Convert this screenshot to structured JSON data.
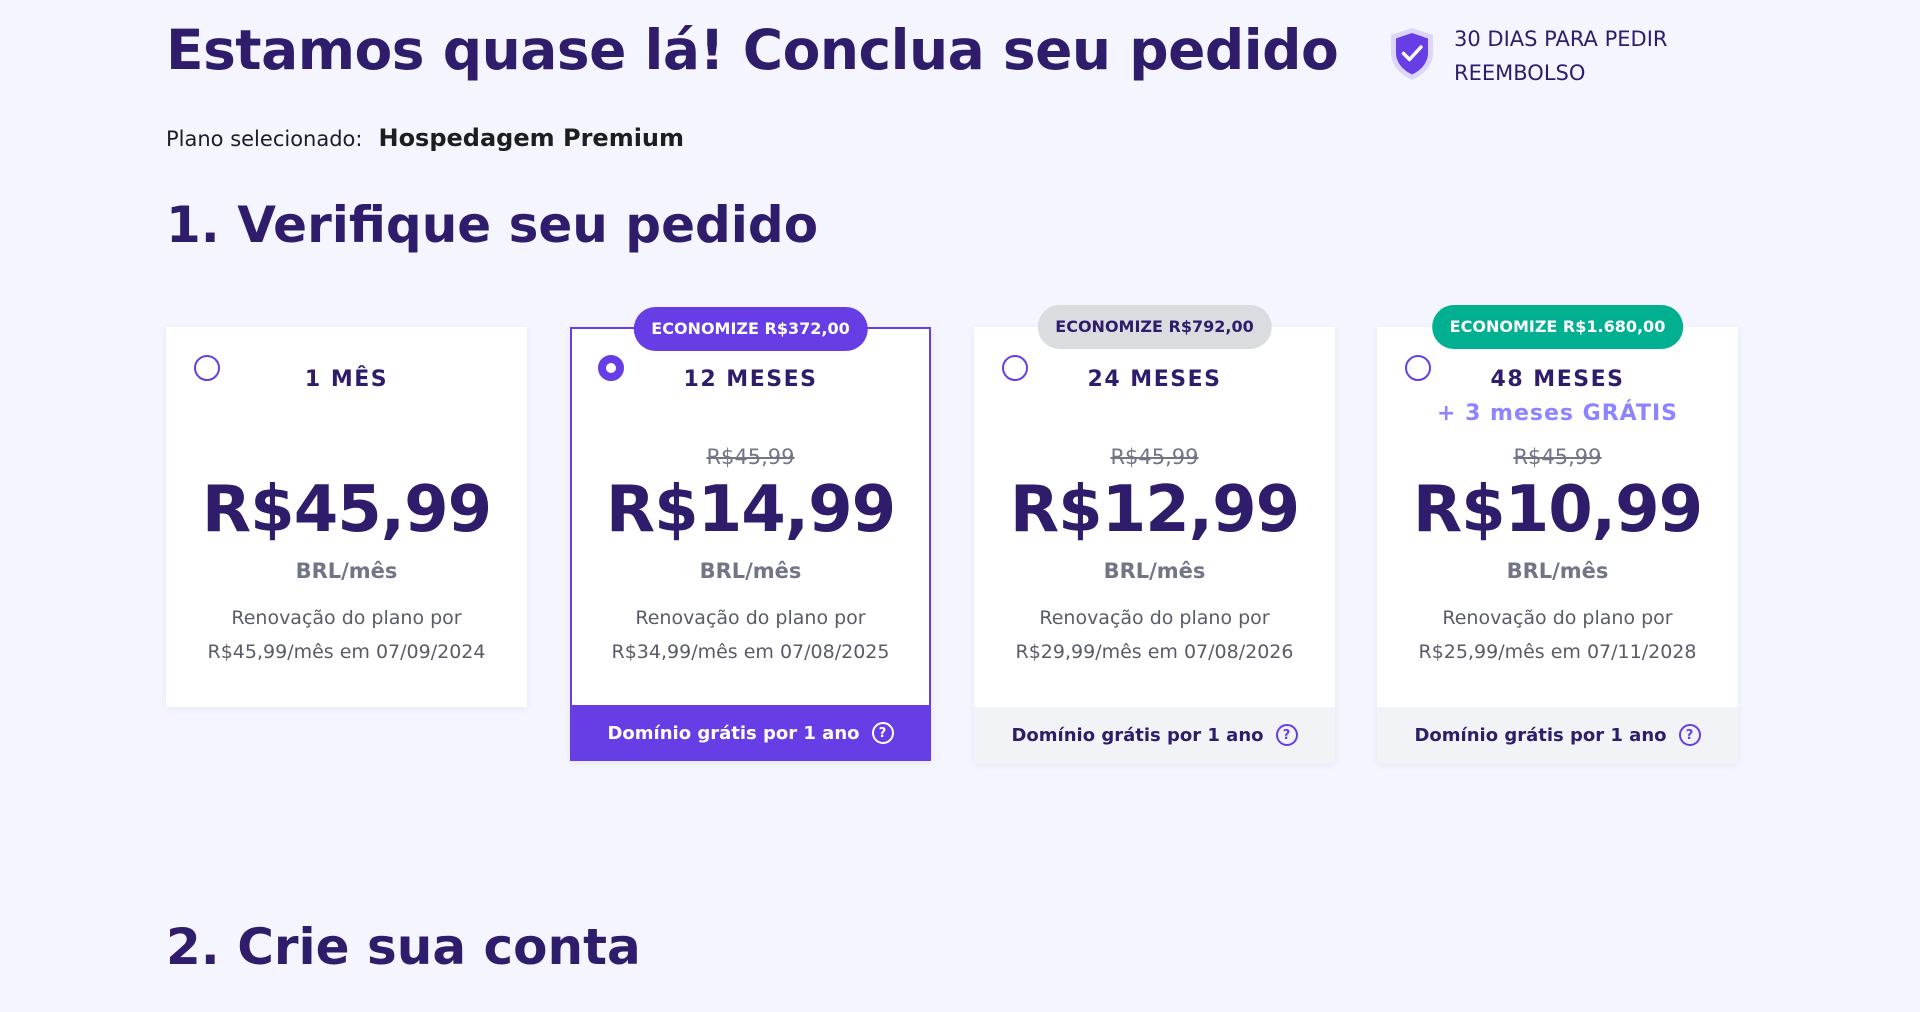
{
  "header": {
    "title": "Estamos quase lá! Conclua seu pedido",
    "guarantee_text": "30 DIAS PARA PEDIR REEMBOLSO"
  },
  "plan": {
    "label": "Plano selecionado:",
    "name": "Hospedagem Premium"
  },
  "sections": {
    "review_title": "1. Verifique seu pedido",
    "account_title": "2. Crie sua conta"
  },
  "colors": {
    "accent": "#673de6",
    "heading": "#2f1c6a",
    "badge_green": "#00b090",
    "badge_gray": "#dadce0"
  },
  "plans": [
    {
      "period": "1 MÊS",
      "bonus": "",
      "badge": "",
      "old_price": "",
      "price": "R$45,99",
      "unit": "BRL/mês",
      "renewal_line1": "Renovação do plano por",
      "renewal_line2": "R$45,99/mês em 07/09/2024",
      "footer": "",
      "selected": false
    },
    {
      "period": "12 MESES",
      "bonus": "",
      "badge": "ECONOMIZE R$372,00",
      "old_price": "R$45,99",
      "price": "R$14,99",
      "unit": "BRL/mês",
      "renewal_line1": "Renovação do plano por",
      "renewal_line2": "R$34,99/mês em 07/08/2025",
      "footer": "Domínio grátis por 1 ano",
      "selected": true
    },
    {
      "period": "24 MESES",
      "bonus": "",
      "badge": "ECONOMIZE R$792,00",
      "old_price": "R$45,99",
      "price": "R$12,99",
      "unit": "BRL/mês",
      "renewal_line1": "Renovação do plano por",
      "renewal_line2": "R$29,99/mês em 07/08/2026",
      "footer": "Domínio grátis por 1 ano",
      "selected": false
    },
    {
      "period": "48 MESES",
      "bonus": "+ 3 meses GRÁTIS",
      "badge": "ECONOMIZE R$1.680,00",
      "old_price": "R$45,99",
      "price": "R$10,99",
      "unit": "BRL/mês",
      "renewal_line1": "Renovação do plano por",
      "renewal_line2": "R$25,99/mês em 07/11/2028",
      "footer": "Domínio grátis por 1 ano",
      "selected": false
    }
  ],
  "icons": {
    "guarantee": "shield-check-icon",
    "help": "question-circle-icon",
    "help_glyph": "?"
  }
}
